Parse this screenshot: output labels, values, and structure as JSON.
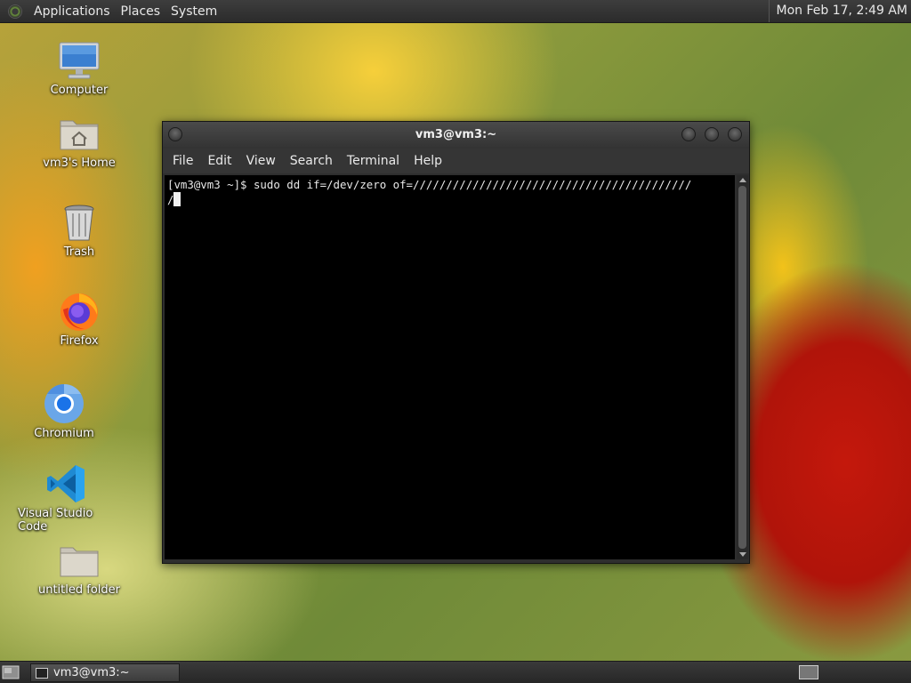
{
  "top_panel": {
    "menus": [
      "Applications",
      "Places",
      "System"
    ],
    "clock": "Mon Feb 17,  2:49 AM"
  },
  "desktop_icons": [
    {
      "label": "Computer",
      "icon": "computer-icon"
    },
    {
      "label": "vm3's Home",
      "icon": "home-folder-icon"
    },
    {
      "label": "Trash",
      "icon": "trash-icon"
    },
    {
      "label": "Firefox",
      "icon": "firefox-icon"
    },
    {
      "label": "Chromium",
      "icon": "chromium-icon"
    },
    {
      "label": "Visual Studio Code",
      "icon": "vscode-icon"
    },
    {
      "label": "untitled folder",
      "icon": "folder-icon"
    }
  ],
  "terminal_window": {
    "title": "vm3@vm3:~",
    "menu": [
      "File",
      "Edit",
      "View",
      "Search",
      "Terminal",
      "Help"
    ],
    "lines": [
      "[vm3@vm3 ~]$ sudo dd if=/dev/zero of=//////////////////////////////////////////",
      "/"
    ]
  },
  "bottom_panel": {
    "task_label": "vm3@vm3:~"
  },
  "colors": {
    "panel_bg": "#2b2b2b",
    "terminal_bg": "#000000",
    "terminal_fg": "#e8e8e8"
  }
}
